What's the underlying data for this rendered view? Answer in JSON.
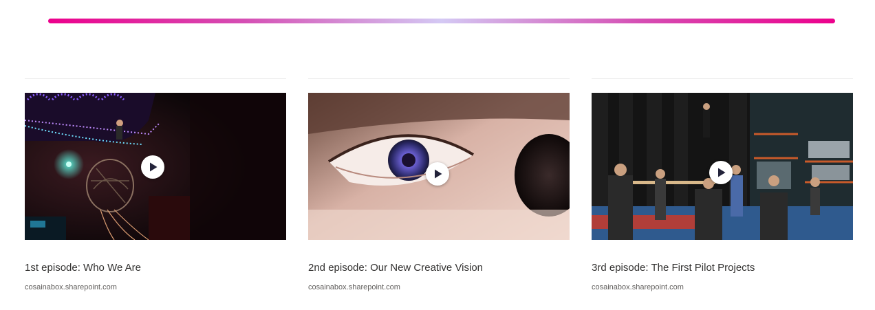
{
  "divider": {
    "gradient_colors": [
      "#ec008c",
      "#d4c9f4",
      "#ec008c"
    ]
  },
  "cards": [
    {
      "title": "1st episode: Who We Are",
      "domain": "cosainabox.sharepoint.com",
      "icon": "play-icon"
    },
    {
      "title": "2nd episode: Our New Creative Vision",
      "domain": "cosainabox.sharepoint.com",
      "icon": "play-icon"
    },
    {
      "title": "3rd episode: The First Pilot Projects",
      "domain": "cosainabox.sharepoint.com",
      "icon": "play-icon"
    }
  ],
  "colors": {
    "title_text": "#323130",
    "domain_text": "#605e5c",
    "accent_pink": "#ec008c"
  }
}
